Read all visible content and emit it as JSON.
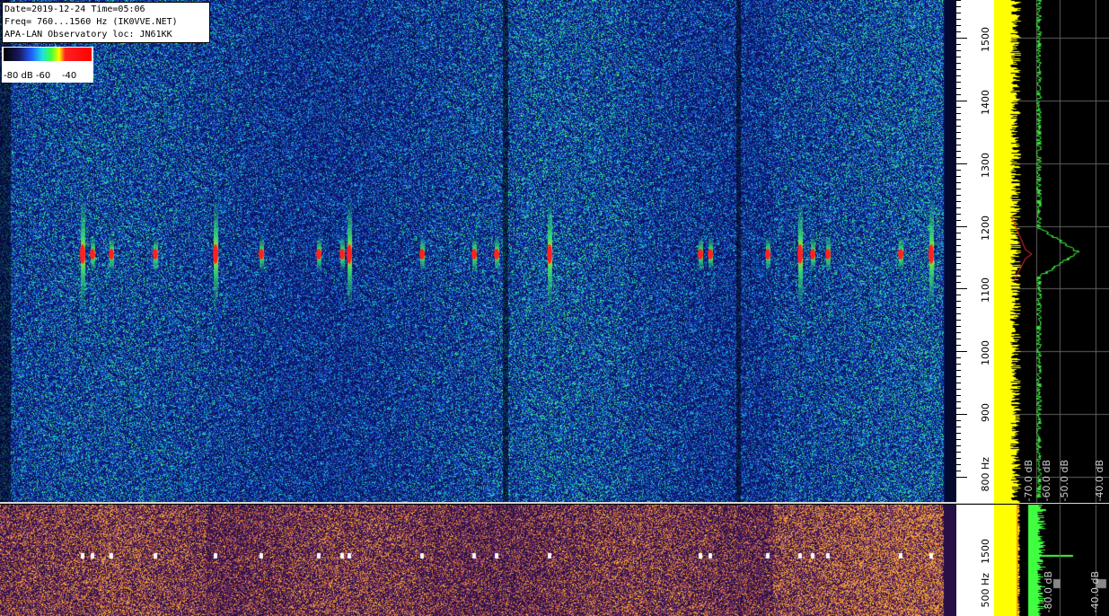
{
  "info": {
    "line1": "Date=2019-12-24 Time=05:06",
    "line2": "Freq= 760...1560 Hz (IK0VVE.NET)",
    "line3": "APA-LAN Observatory loc: JN61KK"
  },
  "legend": {
    "labels": "-80 dB -60    -40"
  },
  "chart_data": {
    "type": "heatmap",
    "title": "",
    "freq_range_hz": [
      760,
      1560
    ],
    "freq_ticks": [
      "800 Hz",
      "900",
      "1000",
      "1100",
      "1200",
      "1300",
      "1400",
      "1500"
    ],
    "freq_tick_values": [
      800,
      900,
      1000,
      1100,
      1200,
      1300,
      1400,
      1500
    ],
    "db_scale": [
      -80,
      -40
    ],
    "spectrum_labels": [
      "-70.0 dB",
      "-60.0 dB",
      "-50.0 dB",
      "-40.0 dB"
    ],
    "lower_freq_ticks": [
      "500 Hz",
      "1500"
    ],
    "lower_db_labels": [
      "-80.0 dB",
      "-40.0 dB"
    ],
    "carrier_hz": 1155,
    "echo_times_px": [
      92,
      103,
      124,
      173,
      240,
      291,
      355,
      381,
      389,
      470,
      528,
      553,
      612,
      780,
      791,
      855,
      891,
      905,
      922,
      1003,
      1037
    ],
    "colors": {
      "background": "#1a2a80",
      "noise_mid": "#2060ff",
      "noise_high": "#20d0d0",
      "signal": "#ff2020",
      "spectrum_yellow": "#ffff00",
      "spectrum_green": "#40ff40",
      "spectrum_red": "#ff3030"
    }
  }
}
